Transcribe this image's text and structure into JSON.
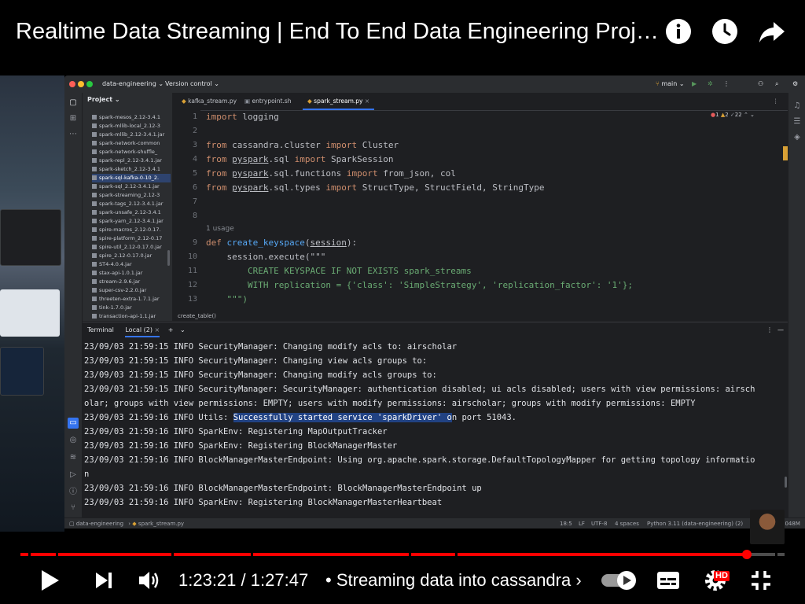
{
  "video": {
    "title": "Realtime Data Streaming | End To End Data Engineering Proj…",
    "time_current": "1:23:21",
    "time_separator": "/",
    "time_total": "1:27:47",
    "chapter_prefix": "•",
    "chapter": "Streaming data into cassandra",
    "chapter_chevron": "›",
    "quality_badge": "HD",
    "progress_fraction": 0.951,
    "accent_color": "#ff0000"
  },
  "top_icons": [
    "info-icon",
    "clock-icon",
    "share-icon"
  ],
  "controls": [
    "play-icon",
    "next-icon",
    "volume-icon",
    "autoplay-toggle",
    "subtitles-icon",
    "settings-icon",
    "exit-fullscreen-icon"
  ],
  "ide": {
    "project_name": "data-engineering",
    "vcs_label": "Version control",
    "branch": "main",
    "project_panel_title": "Project",
    "tree_items": [
      "spark-mesos_2.12-3.4.1",
      "spark-mllib-local_2.12-3",
      "spark-mllib_2.12-3.4.1.jar",
      "spark-network-common",
      "spark-network-shuffle_",
      "spark-repl_2.12-3.4.1.jar",
      "spark-sketch_2.12-3.4.1",
      "spark-sql-kafka-0-10_2.",
      "spark-sql_2.12-3.4.1.jar",
      "spark-streaming_2.12-3",
      "spark-tags_2.12-3.4.1.jar",
      "spark-unsafe_2.12-3.4.1",
      "spark-yarn_2.12-3.4.1.jar",
      "spire-macros_2.12-0.17.",
      "spire-platform_2.12-0.17",
      "spire-util_2.12-0.17.0.jar",
      "spire_2.12-0.17.0.jar",
      "ST4-4.0.4.jar",
      "stax-api-1.0.1.jar",
      "stream-2.9.6.jar",
      "super-csv-2.2.0.jar",
      "threeten-extra-1.7.1.jar",
      "tink-1.7.0.jar",
      "transaction-api-1.1.jar"
    ],
    "tabs": [
      "kafka_stream.py",
      "entrypoint.sh",
      "spark_stream.py"
    ],
    "inspection_counts": {
      "errors": "1",
      "warnings": "2",
      "weak": "22"
    },
    "line_numbers": [
      "1",
      "2",
      "3",
      "4",
      "5",
      "6",
      "7",
      "8",
      "9",
      "10",
      "11",
      "12",
      "13"
    ],
    "code": {
      "l1_kw": "import",
      "l1_rest": " logging",
      "l3_kw1": "from",
      "l3_mod": " cassandra.cluster ",
      "l3_kw2": "import",
      "l3_rest": " Cluster",
      "l4_kw1": "from",
      "l4_mod": "pyspark",
      "l4_mod2": ".sql ",
      "l4_kw2": "import",
      "l4_rest": " SparkSession",
      "l5_kw1": "from",
      "l5_mod": "pyspark",
      "l5_mod2": ".sql.functions ",
      "l5_kw2": "import",
      "l5_rest": " from_json, col",
      "l6_kw1": "from",
      "l6_mod": "pyspark",
      "l6_mod2": ".sql.types ",
      "l6_kw2": "import",
      "l6_rest": " StructType, StructField, StringType",
      "usage_hint": "1 usage",
      "l9_kw": "def",
      "l9_fn": "create_keyspace",
      "l9_param": "session",
      "l9_end": "):",
      "l10": "    session.execute(\"\"\"",
      "l11": "        CREATE KEYSPACE IF NOT EXISTS spark_streams",
      "l12": "        WITH replication = {'class': 'SimpleStrategy', 'replication_factor': '1'};",
      "l13": "    \"\"\")"
    },
    "breadcrumb": "create_table()",
    "terminal_tab": "Terminal",
    "terminal_session": "Local (2)",
    "terminal_lines": [
      "23/09/03 21:59:15 INFO SecurityManager: Changing modify acls to: airscholar",
      "23/09/03 21:59:15 INFO SecurityManager: Changing view acls groups to:",
      "23/09/03 21:59:15 INFO SecurityManager: Changing modify acls groups to:",
      "23/09/03 21:59:15 INFO SecurityManager: SecurityManager: authentication disabled; ui acls disabled; users with view permissions: airsch",
      "olar; groups with view permissions: EMPTY; users with modify permissions: airscholar; groups with modify permissions: EMPTY"
    ],
    "utils_line_prefix": "23/09/03 21:59:16 INFO Utils: ",
    "utils_line_selected": "Successfully started service 'sparkDriver' o",
    "utils_line_suffix": "n port 51043.",
    "terminal_lines_after": [
      "23/09/03 21:59:16 INFO SparkEnv: Registering MapOutputTracker",
      "23/09/03 21:59:16 INFO SparkEnv: Registering BlockManagerMaster",
      "23/09/03 21:59:16 INFO BlockManagerMasterEndpoint: Using org.apache.spark.storage.DefaultTopologyMapper for getting topology informatio",
      "n",
      "23/09/03 21:59:16 INFO BlockManagerMasterEndpoint: BlockManagerMasterEndpoint up",
      "23/09/03 21:59:16 INFO SparkEnv: Registering BlockManagerMasterHeartbeat"
    ],
    "status": {
      "path_project": "data-engineering",
      "path_file": "spark_stream.py",
      "position": "18:5",
      "line_sep": "LF",
      "encoding": "UTF-8",
      "indent": "4 spaces",
      "interpreter": "Python 3.11 (data-engineering) (2)",
      "memory": "2048M"
    }
  }
}
